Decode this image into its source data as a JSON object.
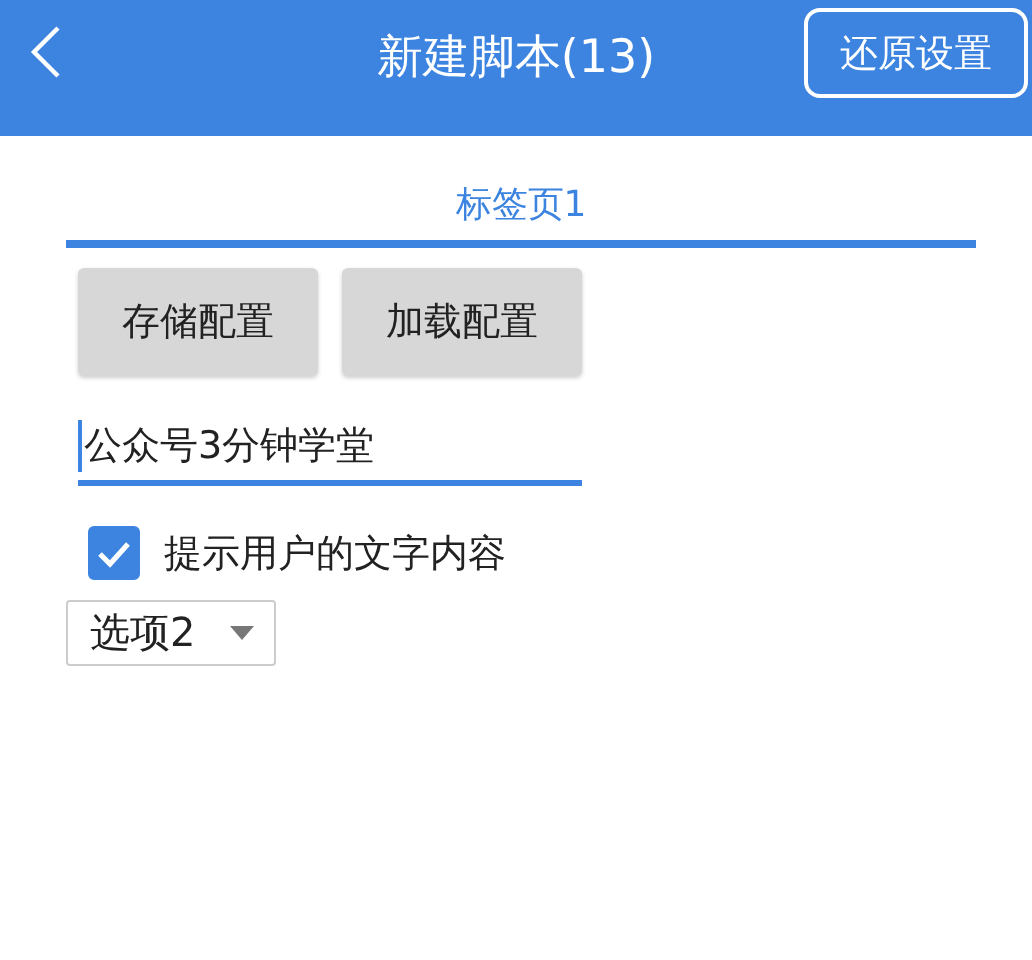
{
  "header": {
    "title": "新建脚本(13)",
    "action_button": "还原设置"
  },
  "tabs": [
    {
      "label": "标签页1",
      "selected": true
    }
  ],
  "buttons": [
    "存储配置",
    "加载配置"
  ],
  "text_field": {
    "value": "公众号3分钟学堂",
    "focused": true
  },
  "checkbox": {
    "label": "提示用户的文字内容",
    "checked": true
  },
  "select": {
    "value": "选项2"
  }
}
